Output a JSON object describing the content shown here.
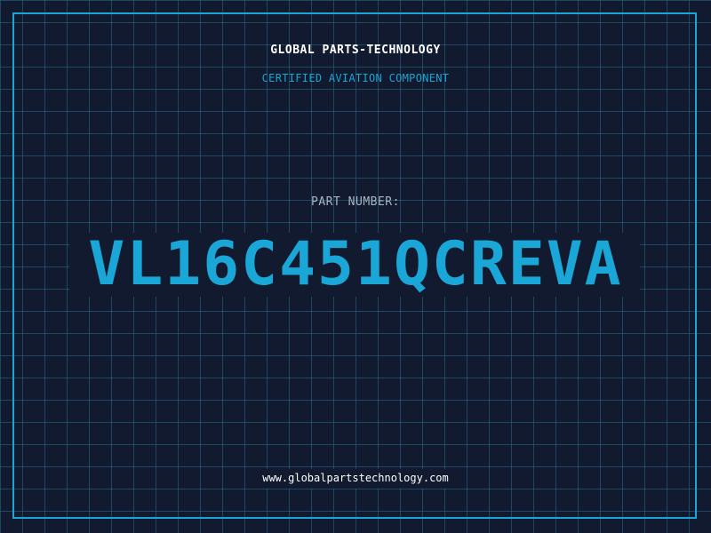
{
  "label": {
    "company": "GLOBAL PARTS-TECHNOLOGY",
    "subtitle": "CERTIFIED AVIATION COMPONENT",
    "part_number_label": "PART NUMBER:",
    "part_number": "VL16C451QCREVA",
    "website": "www.globalpartstechnology.com"
  },
  "colors": {
    "background": "#111a2e",
    "accent": "#1aa6d6",
    "text_primary": "#ffffff",
    "text_muted": "#aab4c2"
  }
}
